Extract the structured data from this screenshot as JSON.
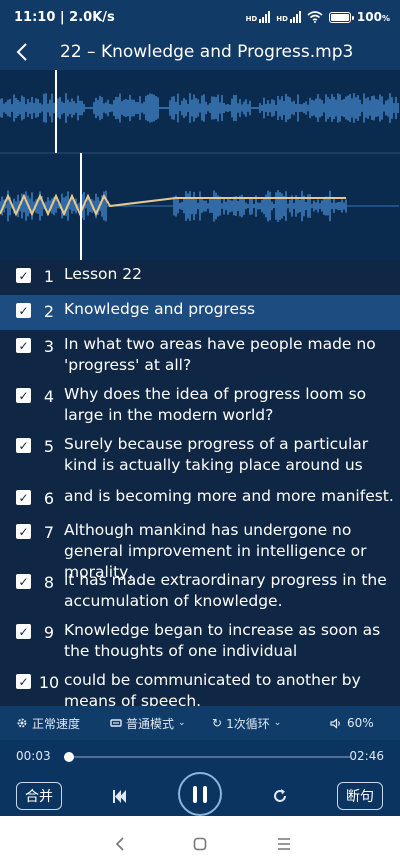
{
  "status": {
    "time_speed": "11:10 | 2.0K/s",
    "signal1_label": "HD",
    "signal2_label": "HD",
    "battery": "100",
    "battery_unit": "%",
    "battery_level": 1.0
  },
  "header": {
    "back_icon": "chevron-left-icon",
    "title": "22 – Knowledge and Progress.mp3"
  },
  "sentences": [
    {
      "num": "1",
      "text": "Lesson 22",
      "checked": true,
      "active": false
    },
    {
      "num": "2",
      "text": "Knowledge and progress",
      "checked": true,
      "active": true
    },
    {
      "num": "3",
      "text": "In what two areas have people made no 'progress' at all?",
      "checked": true,
      "active": false
    },
    {
      "num": "4",
      "text": "Why does the idea of progress loom so large in the modern world?",
      "checked": true,
      "active": false
    },
    {
      "num": "5",
      "text": "Surely because progress of a particular kind is actually taking place around us",
      "checked": true,
      "active": false
    },
    {
      "num": "6",
      "text": "and is becoming more and more manifest.",
      "checked": true,
      "active": false
    },
    {
      "num": "7",
      "text": "Although mankind has undergone no general improvement in intelligence or morality,",
      "checked": true,
      "active": false
    },
    {
      "num": "8",
      "text": "it has made extraordinary progress in the accumulation of knowledge.",
      "checked": true,
      "active": false
    },
    {
      "num": "9",
      "text": "Knowledge began to increase as soon as the thoughts of one individual",
      "checked": true,
      "active": false
    },
    {
      "num": "10",
      "text": "could be communicated to another by means of speech.",
      "checked": true,
      "active": false
    }
  ],
  "options": {
    "speed": "正常速度",
    "mode": "普通模式",
    "loop": "1次循环",
    "volume": "60%"
  },
  "progress": {
    "current": "00:03",
    "total": "02:46",
    "fraction": 0.018
  },
  "buttons": {
    "merge": "合并",
    "split": "断句"
  },
  "colors": {
    "background": "#0f2744",
    "accent_active_row": "#1d4d80",
    "waveform": "#4a90d9",
    "pitch_line": "#e8c88a"
  }
}
